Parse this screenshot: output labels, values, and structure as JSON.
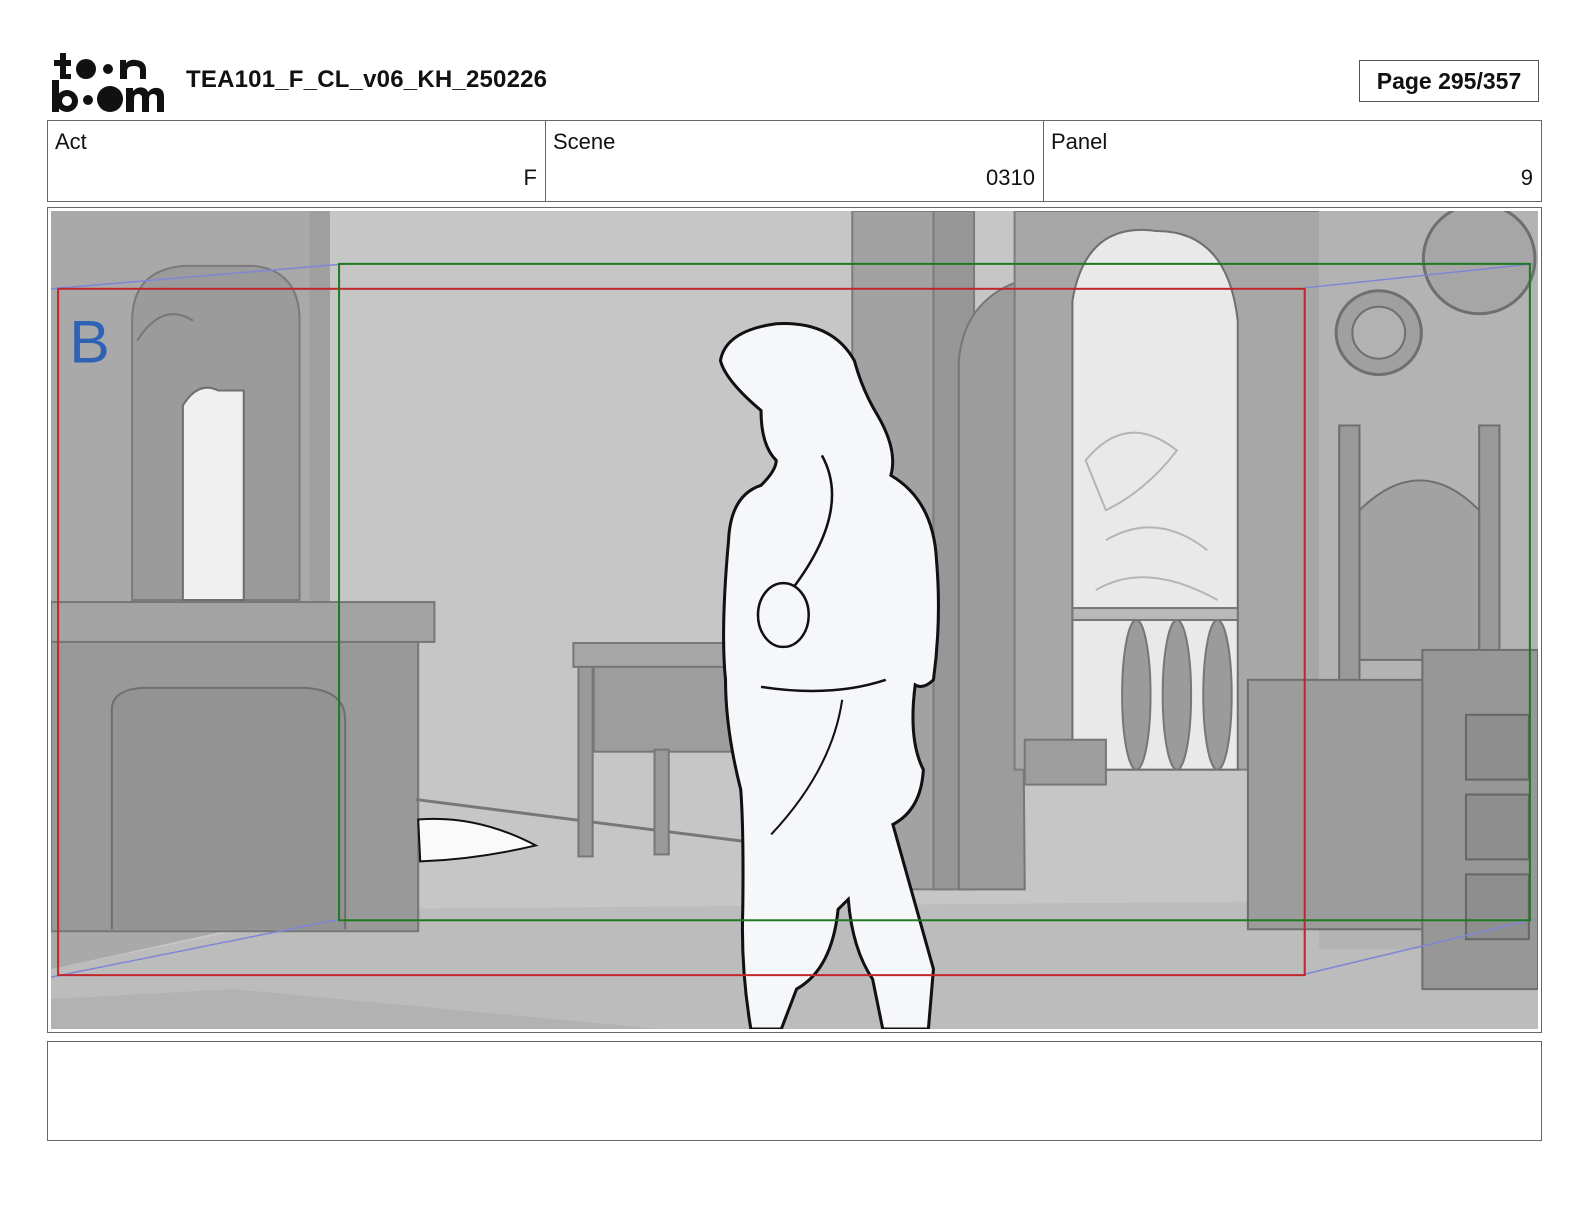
{
  "header": {
    "logo_text": "toon boom",
    "title": "TEA101_F_CL_v06_KH_250226",
    "page": "Page 295/357"
  },
  "info": {
    "act_label": "Act",
    "act_value": "F",
    "scene_label": "Scene",
    "scene_value": "0310",
    "panel_label": "Panel",
    "panel_value": "9"
  },
  "panel": {
    "layer_letter": "B",
    "colors": {
      "background": "#c4c4c4",
      "wall_dark": "#9a9a9a",
      "figure_fill": "#f6f7fa",
      "safe_frame_red": "#c0272d",
      "safe_frame_green": "#1f7a1f",
      "guide_blue": "#7f86d6",
      "layer_letter": "#2f62b5"
    }
  },
  "notes": {
    "text": ""
  }
}
